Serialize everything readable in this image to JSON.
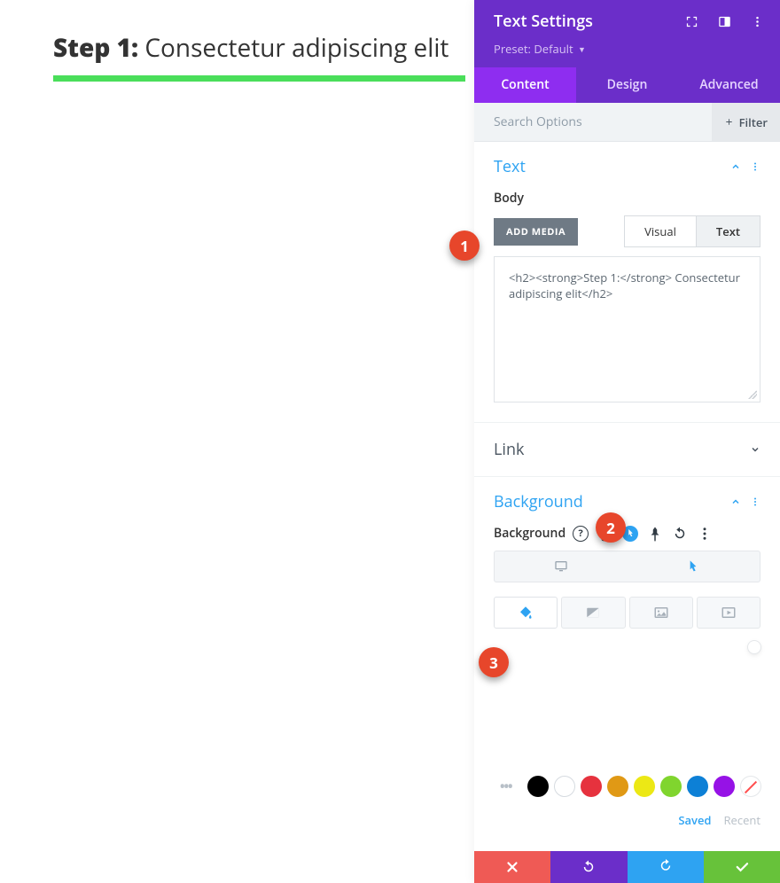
{
  "page": {
    "heading_strong": "Step 1:",
    "heading_rest": " Consectetur adipiscing elit"
  },
  "header": {
    "title": "Text Settings",
    "preset_label": "Preset:",
    "preset_value": "Default"
  },
  "tabs": {
    "content": "Content",
    "design": "Design",
    "advanced": "Advanced"
  },
  "search": {
    "placeholder": "Search Options",
    "filter_label": "Filter"
  },
  "text_section": {
    "title": "Text",
    "body_label": "Body",
    "add_media": "ADD MEDIA",
    "editor_tabs": {
      "visual": "Visual",
      "text": "Text"
    },
    "code": "<h2><strong>Step 1:</strong> Consectetur adipiscing elit</h2>"
  },
  "link_section": {
    "title": "Link"
  },
  "background_section": {
    "title": "Background",
    "label": "Background"
  },
  "palette": {
    "saved": "Saved",
    "recent": "Recent"
  },
  "callouts": {
    "one": "1",
    "two": "2",
    "three": "3"
  }
}
